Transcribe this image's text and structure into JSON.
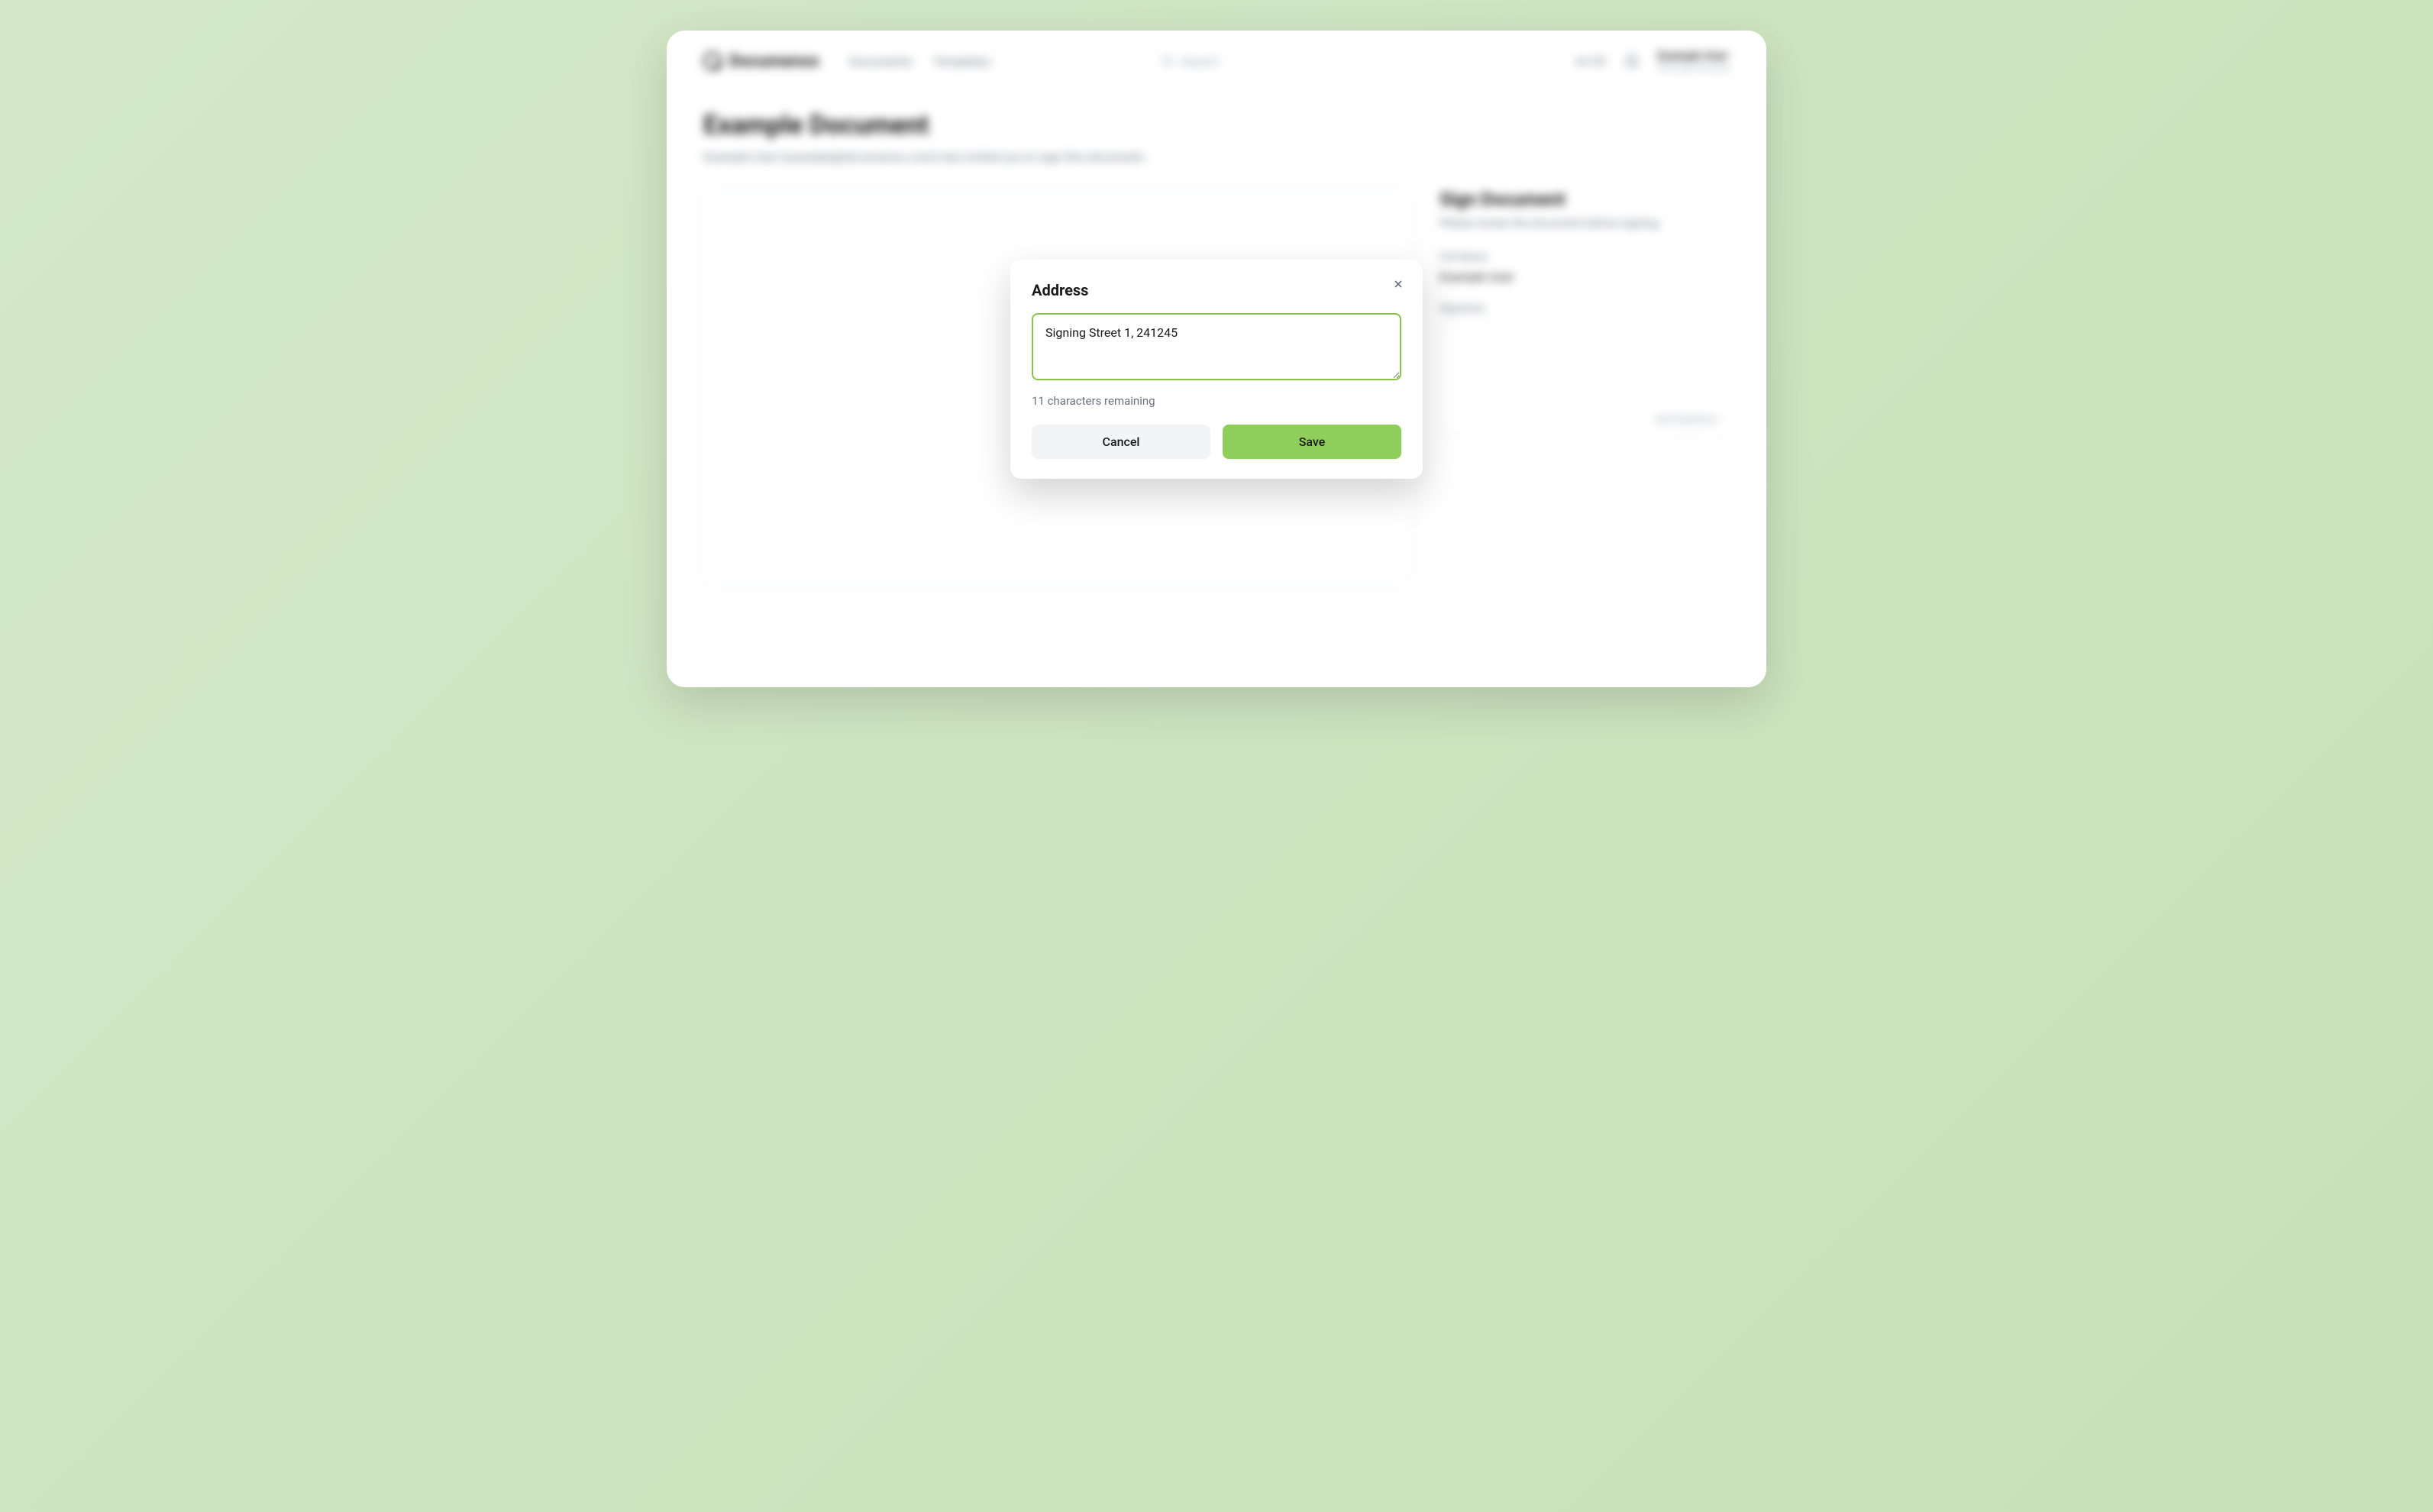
{
  "header": {
    "brand": "Documenso",
    "nav": {
      "documents": "Documents",
      "templates": "Templates"
    },
    "search_placeholder": "Search",
    "lang": "en-US",
    "user": {
      "name": "Example User",
      "sub": "Personal Account"
    }
  },
  "page": {
    "title": "Example Document",
    "subtitle": "Example User (example@documenso.com) has invited you to sign this document."
  },
  "side": {
    "title": "Sign Document",
    "subtitle": "Please review the document before signing.",
    "full_name_label": "Full Name",
    "full_name_value": "Example User",
    "signature_label": "Signature",
    "signature_hint": "Add Signature"
  },
  "modal": {
    "title": "Address",
    "value": "Signing Street 1, 241245",
    "remaining": "11 characters remaining",
    "cancel": "Cancel",
    "save": "Save"
  }
}
